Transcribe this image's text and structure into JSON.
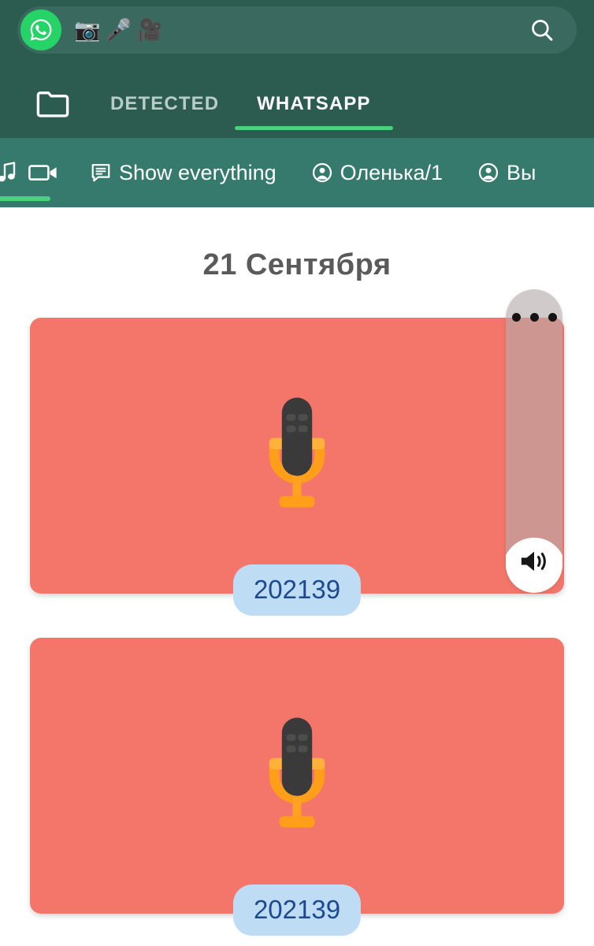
{
  "topbar": {
    "whatsapp_icon": "whatsapp-logo-icon",
    "emojis": [
      {
        "name": "camera-emoji",
        "glyph": "📷"
      },
      {
        "name": "microphone-emoji",
        "glyph": "🎤"
      },
      {
        "name": "movie-camera-emoji",
        "glyph": "🎥"
      }
    ],
    "search_icon": "search-icon",
    "background_color": "#2c5b50",
    "pill_color": "#3a6a5f"
  },
  "tabs": {
    "folder_icon": "folder-icon",
    "items": [
      {
        "label": "DETECTED",
        "active": false
      },
      {
        "label": "WHATSAPP",
        "active": true
      }
    ],
    "active_underline_color": "#4bd07e"
  },
  "filterbar": {
    "background_color": "#357a6c",
    "media_icons": [
      {
        "name": "music-note-icon"
      },
      {
        "name": "video-camera-icon",
        "active": true
      }
    ],
    "chips": [
      {
        "icon": "chat-bubble-icon",
        "label": "Show everything"
      },
      {
        "icon": "account-circle-icon",
        "label": "Оленька/1"
      },
      {
        "icon": "account-circle-icon",
        "label": "Вы"
      }
    ]
  },
  "content": {
    "date_header": "21 Сентября",
    "card_color": "#f4766a",
    "pill_bg_color": "#bfdcf5",
    "pill_text_color": "#1d4a8f",
    "cards": [
      {
        "thumbnail_icon": "microphone-icon",
        "time_label": "202139"
      },
      {
        "thumbnail_icon": "microphone-icon",
        "time_label": "202139"
      }
    ]
  },
  "side_panel": {
    "menu_icon": "more-horizontal-icon",
    "volume_icon": "volume-up-icon"
  }
}
